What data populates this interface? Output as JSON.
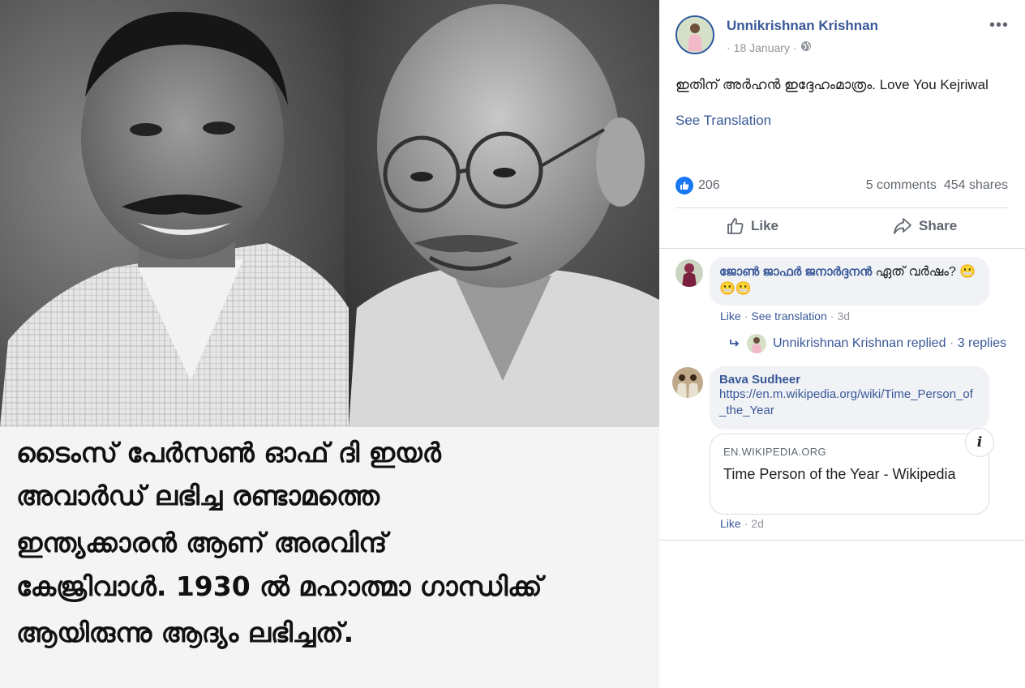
{
  "image": {
    "caption_lines": [
      "ടൈംസ് പേർസൺ ഓഫ് ദി ഇയർ",
      "അവാർഡ് ലഭിച്ച രണ്ടാമത്തെ",
      "ഇന്ത്യക്കാരൻ  ആണ് അരവിന്ദ്",
      "കേജ്രിവാൾ. 1930 ൽ മഹാത്മാ ഗാന്ധിക്ക്",
      "ആയിരുന്നു ആദ്യം ലഭിച്ചത്."
    ]
  },
  "post": {
    "author": "Unnikrishnan Krishnan",
    "date": "18 January",
    "separator": "·",
    "more_label": "•••",
    "text": "ഇതിന് അർഹൻ ഇദ്ദേഹംമാത്രം. Love You Kejriwal",
    "see_translation": "See Translation",
    "reaction_count": "206",
    "comments_count": "5 comments",
    "shares_count": "454 shares",
    "like_label": "Like",
    "share_label": "Share"
  },
  "comments": [
    {
      "name": "ജോൺ ജാഫർ ജനാർദ്ദനൻ",
      "text": "ഏത് വർഷം? 😬😬😬",
      "like": "Like",
      "see_translation": "See translation",
      "age": "3d",
      "reply_author": "Unnikrishnan Krishnan",
      "reply_text": "replied",
      "reply_count": "3 replies"
    },
    {
      "name": "Bava Sudheer",
      "link": "https://en.m.wikipedia.org/wiki/Time_Person_of_the_Year",
      "card_domain": "EN.WIKIPEDIA.ORG",
      "card_title": "Time Person of the Year - Wikipedia",
      "info": "i",
      "like": "Like",
      "age": "2d"
    }
  ],
  "colors": {
    "link_blue": "#385898",
    "like_blue": "#1877f2",
    "muted_gray": "#90949c",
    "bubble_bg": "#f0f2f5"
  }
}
